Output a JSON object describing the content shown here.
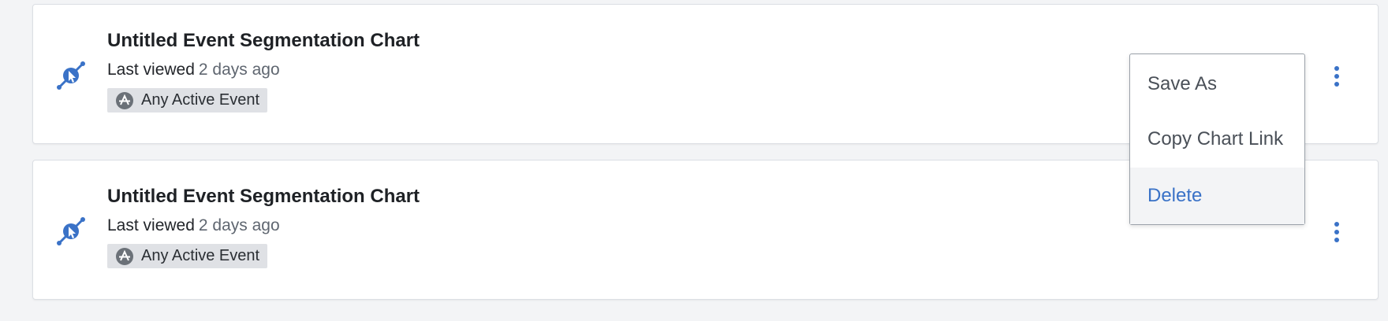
{
  "charts": [
    {
      "title": "Untitled Event Segmentation Chart",
      "last_viewed_label": "Last viewed",
      "last_viewed_value": "2 days ago",
      "event_tag": "Any Active Event",
      "icon": "segmentation-chart-icon",
      "tag_icon": "any-event-icon"
    },
    {
      "title": "Untitled Event Segmentation Chart",
      "last_viewed_label": "Last viewed",
      "last_viewed_value": "2 days ago",
      "event_tag": "Any Active Event",
      "icon": "segmentation-chart-icon",
      "tag_icon": "any-event-icon"
    }
  ],
  "menu": {
    "items": [
      {
        "label": "Save As"
      },
      {
        "label": "Copy Chart Link"
      },
      {
        "label": "Delete",
        "highlighted": true
      }
    ]
  },
  "colors": {
    "accent": "#3a72c7",
    "background": "#f3f4f6",
    "card": "#ffffff",
    "tag_background": "#dfe1e5"
  }
}
